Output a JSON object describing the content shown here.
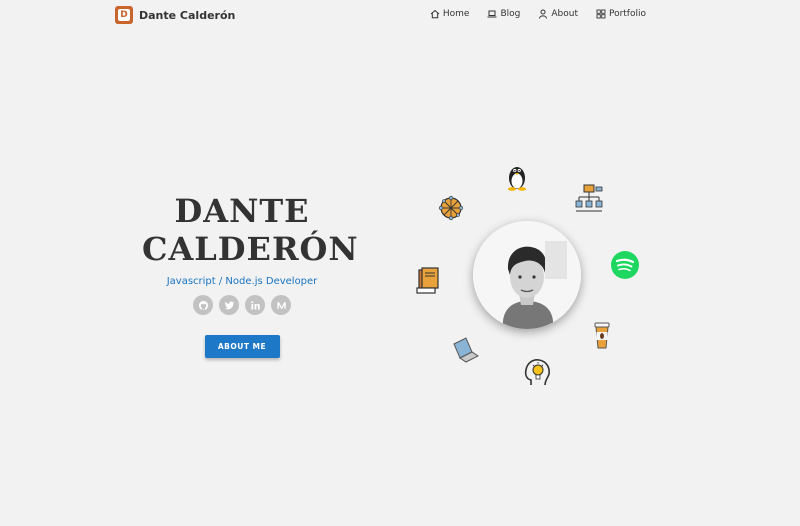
{
  "brand": {
    "logo_letter": "D",
    "name": "Dante Calderón"
  },
  "nav": [
    {
      "label": "Home",
      "icon": "home-icon"
    },
    {
      "label": "Blog",
      "icon": "laptop-icon"
    },
    {
      "label": "About",
      "icon": "user-icon"
    },
    {
      "label": "Portfolio",
      "icon": "grid-icon"
    }
  ],
  "hero": {
    "name_line1": "DANTE",
    "name_line2": "CALDERÓN",
    "role": "Javascript / Node.js Developer",
    "socials": [
      "github-icon",
      "twitter-icon",
      "linkedin-icon",
      "medium-icon"
    ],
    "cta_label": "ABOUT ME"
  },
  "orbit_icons": [
    "linux-icon",
    "network-globe-icon",
    "flowchart-icon",
    "books-icon",
    "spotify-icon",
    "laptop-icon",
    "coffee-icon",
    "idea-head-icon"
  ],
  "colors": {
    "accent": "#1e78c8",
    "brand": "#c9642c",
    "spotify": "#1ed760",
    "background": "#f2f2f2"
  }
}
